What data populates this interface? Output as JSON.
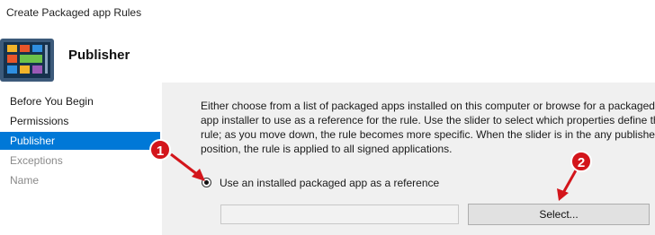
{
  "window": {
    "title": "Create Packaged app Rules"
  },
  "header": {
    "title": "Publisher",
    "icon": "packaged-app-rules-icon"
  },
  "sidebar": {
    "items": [
      {
        "label": "Before You Begin",
        "state": "normal"
      },
      {
        "label": "Permissions",
        "state": "normal"
      },
      {
        "label": "Publisher",
        "state": "active"
      },
      {
        "label": "Exceptions",
        "state": "disabled"
      },
      {
        "label": "Name",
        "state": "disabled"
      }
    ]
  },
  "main": {
    "description_lines": [
      "Either choose from a list of packaged apps installed on this computer or browse for a packaged",
      "app installer to use as a reference for the rule. Use the slider to select which properties define the",
      "rule; as you move down, the rule becomes more specific. When the slider is in the any publisher",
      "position, the rule is applied to all signed applications."
    ],
    "radio_installed_app": {
      "label": "Use an installed packaged app as a reference",
      "checked": true
    },
    "reference_path": {
      "value": ""
    },
    "select_button": {
      "label": "Select..."
    }
  },
  "annotations": [
    {
      "number": "1"
    },
    {
      "number": "2"
    }
  ],
  "colors": {
    "accent": "#0078d7",
    "annotation": "#d3151b",
    "content_bg": "#f0f0f0",
    "disabled_text": "#8a8a8a"
  }
}
